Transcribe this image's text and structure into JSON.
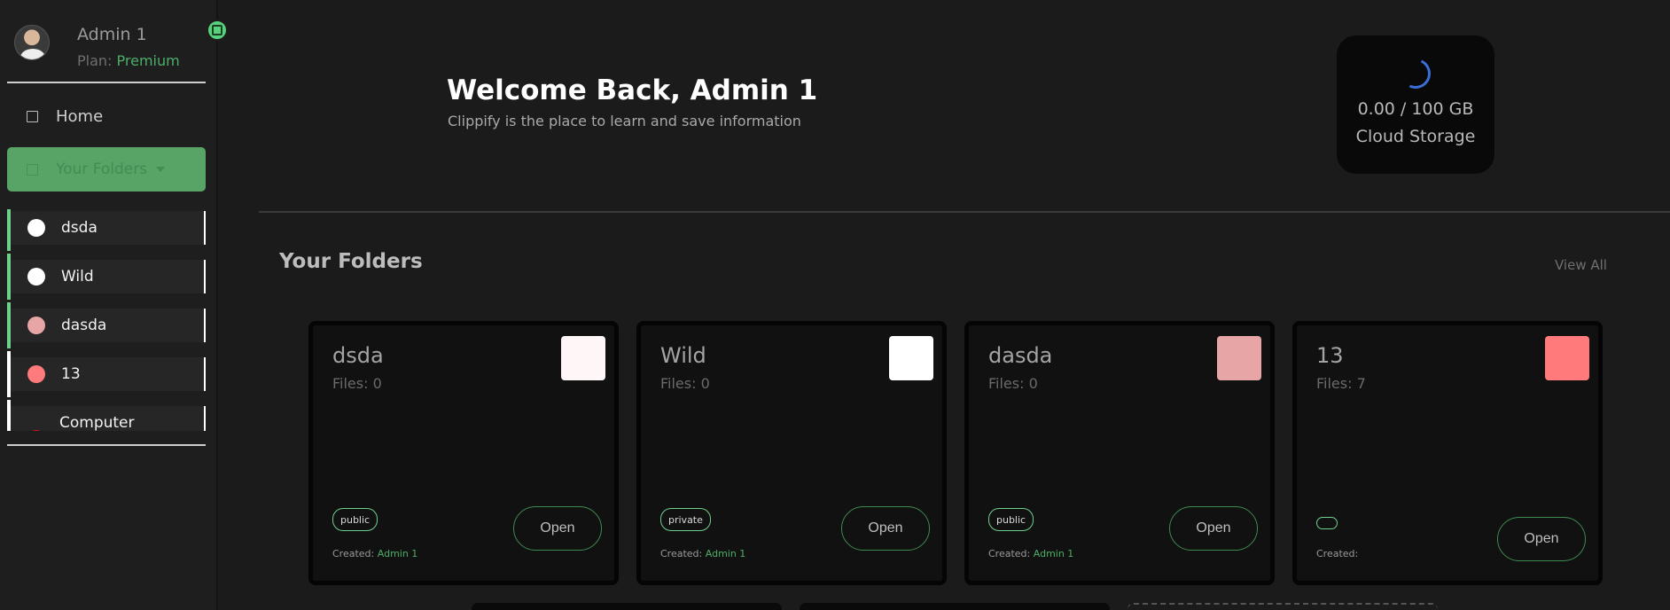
{
  "profile": {
    "name": "Admin 1",
    "plan_label": "Plan:",
    "plan_value": "Premium"
  },
  "nav": {
    "home": "Home",
    "folders": "Your Folders"
  },
  "sidebar_folders": [
    {
      "name": "dsda",
      "color": "#ffffff",
      "bar": "#6fd08b"
    },
    {
      "name": "Wild",
      "color": "#ffffff",
      "bar": "#6fd08b"
    },
    {
      "name": "dasda",
      "color": "#e8a5a5",
      "bar": "#6fd08b"
    },
    {
      "name": "13",
      "color": "#ff7b7b",
      "bar": "#ffffff"
    },
    {
      "name": "Computer",
      "color": "#e0151b",
      "bar": "#ffffff"
    }
  ],
  "welcome": {
    "title": "Welcome Back, Admin 1",
    "subtitle": "Clippify is the place to learn and save information"
  },
  "storage": {
    "amount": "0.00 / 100 GB",
    "label": "Cloud Storage"
  },
  "folders_section": {
    "title": "Your Folders",
    "view_all": "View All"
  },
  "cards": [
    {
      "name": "dsda",
      "files": "Files: 0",
      "swatch": "#fff7f7",
      "visibility": "public",
      "created_label": "Created:",
      "created_by": "Admin 1",
      "open": "Open"
    },
    {
      "name": "Wild",
      "files": "Files: 0",
      "swatch": "#ffffff",
      "visibility": "private",
      "created_label": "Created:",
      "created_by": "Admin 1",
      "open": "Open"
    },
    {
      "name": "dasda",
      "files": "Files: 0",
      "swatch": "#e8a5a5",
      "visibility": "public",
      "created_label": "Created:",
      "created_by": "Admin 1",
      "open": "Open"
    },
    {
      "name": "13",
      "files": "Files: 7",
      "swatch": "#ff7b7b",
      "visibility": "",
      "created_label": "Created:",
      "created_by": "",
      "open": "Open"
    }
  ],
  "colors": {
    "accent": "#57a466",
    "accent_light": "#6fd08b",
    "background": "#1b1b1b"
  }
}
